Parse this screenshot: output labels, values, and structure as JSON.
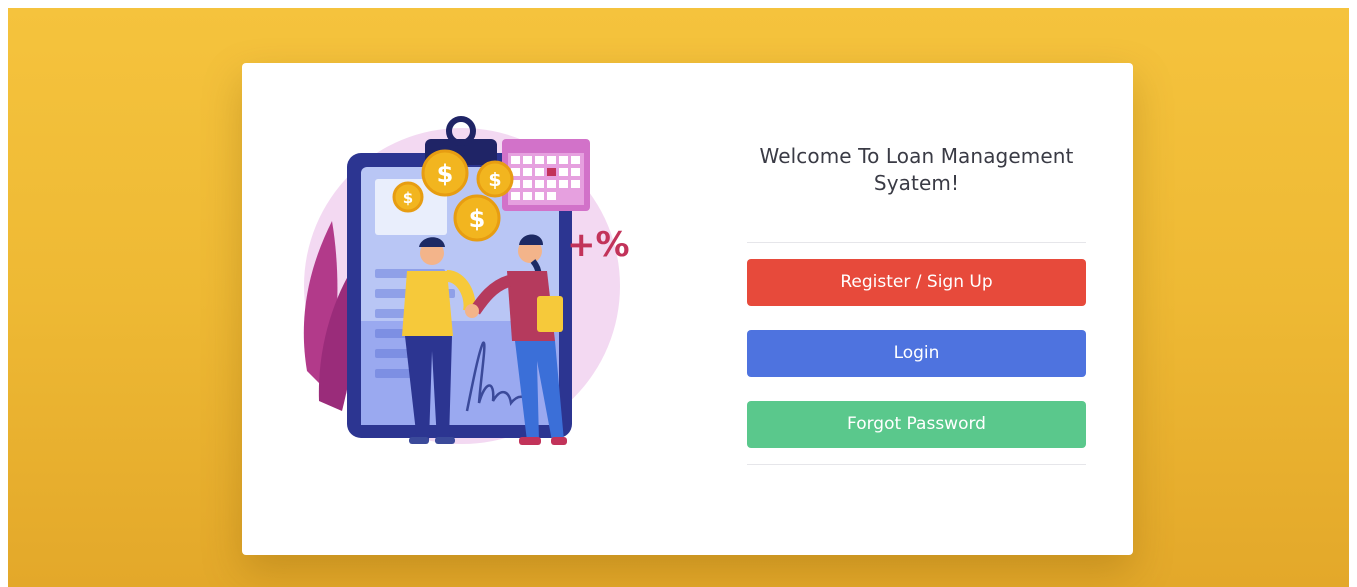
{
  "welcome": {
    "line1": "Welcome To Loan Management",
    "line2": "Syatem!"
  },
  "actions": {
    "register_label": "Register / Sign Up",
    "login_label": "Login",
    "forgot_label": "Forgot Password"
  },
  "illustration": {
    "coin_symbol": "$",
    "badge_text": "+%"
  },
  "colors": {
    "background": "#f3bf3a",
    "register": "#e74a3b",
    "login": "#4e73df",
    "forgot": "#5ac88c"
  }
}
